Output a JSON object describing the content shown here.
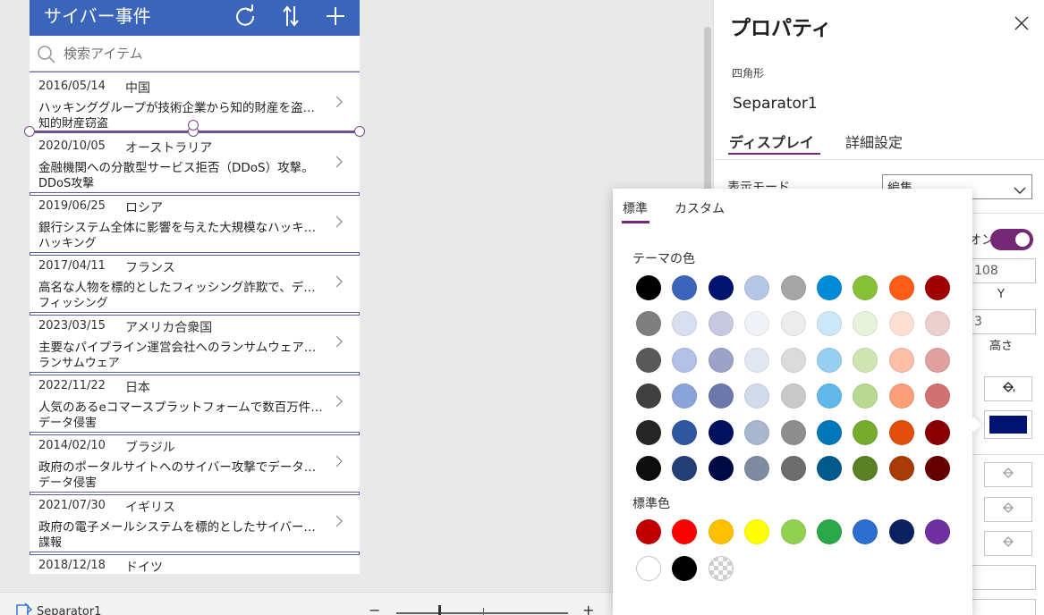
{
  "app": {
    "title": "サイバー事件",
    "search_placeholder": "検索アイテム",
    "rows": [
      {
        "date": "2016/05/14",
        "country": "中国",
        "desc": "ハッキンググループが技術企業から知的財産を盗…",
        "category": "知的財産窃盗"
      },
      {
        "date": "2020/10/05",
        "country": "オーストラリア",
        "desc": "金融機関への分散型サービス拒否（DDoS）攻撃。",
        "category": "DDoS攻撃"
      },
      {
        "date": "2019/06/25",
        "country": "ロシア",
        "desc": "銀行システム全体に影響を与えた大規模なハッキ…",
        "category": "ハッキング"
      },
      {
        "date": "2017/04/11",
        "country": "フランス",
        "desc": "高名な人物を標的としたフィッシング詐欺で、デ…",
        "category": "フィッシング"
      },
      {
        "date": "2023/03/15",
        "country": "アメリカ合衆国",
        "desc": "主要なパイプライン運営会社へのランサムウェア…",
        "category": "ランサムウェア"
      },
      {
        "date": "2022/11/22",
        "country": "日本",
        "desc": "人気のあるeコマースプラットフォームで数百万件…",
        "category": "データ侵害"
      },
      {
        "date": "2014/02/10",
        "country": "ブラジル",
        "desc": "政府のポータルサイトへのサイバー攻撃でデータ…",
        "category": "データ侵害"
      },
      {
        "date": "2021/07/30",
        "country": "イギリス",
        "desc": "政府の電子メールシステムを標的としたサイバー…",
        "category": "諜報"
      },
      {
        "date": "2018/12/18",
        "country": "ドイツ",
        "desc": "",
        "category": ""
      }
    ]
  },
  "status_bar": {
    "selected_control": "Separator1",
    "zoom_minus": "−",
    "zoom_plus": "+"
  },
  "panel": {
    "title": "プロパティ",
    "control_type": "四角形",
    "control_name": "Separator1",
    "tab_display": "ディスプレイ",
    "tab_advanced": "詳細設定",
    "partial_label": "表示モード",
    "display_mode_value": "編集",
    "toggle_text": "オン",
    "field_y_value": "108",
    "caption_y": "Y",
    "field_height_value": "3",
    "caption_height": "高さ",
    "fill_color": "#001370"
  },
  "color_picker": {
    "tab_standard": "標準",
    "tab_custom": "カスタム",
    "theme_heading": "テーマの色",
    "standard_heading": "標準色",
    "theme_rows": [
      [
        "#000000",
        "#3a65ba",
        "#001370",
        "#b5c6e6",
        "#a5a5a5",
        "#0089d6",
        "#88c038",
        "#fd5c19",
        "#a10000"
      ],
      [
        "#7f7f7f",
        "#d8dff1",
        "#c6c9df",
        "#f0f3f8",
        "#ececec",
        "#cbe7f8",
        "#e7f2da",
        "#fde0d4",
        "#ecd0d0"
      ],
      [
        "#595959",
        "#b2c1e5",
        "#9ba2c8",
        "#e2e8f2",
        "#dbdbdb",
        "#96cff0",
        "#cfe5b4",
        "#fcbfa5",
        "#e0a0a0"
      ],
      [
        "#404040",
        "#8aa3d9",
        "#6c77ab",
        "#d2dbeb",
        "#c9c9c9",
        "#62b7e9",
        "#b7d991",
        "#fb9f78",
        "#d17171"
      ],
      [
        "#262626",
        "#2f56a0",
        "#00115f",
        "#a8b6cf",
        "#8e8e8e",
        "#0077b8",
        "#78ac2f",
        "#e24e0c",
        "#8a0000"
      ],
      [
        "#0d0d0d",
        "#243f75",
        "#000b45",
        "#7f8ba0",
        "#6d6d6d",
        "#005a8c",
        "#5a8123",
        "#a93b09",
        "#660000"
      ]
    ],
    "standard_colors": [
      "#c00000",
      "#ff0000",
      "#ffc000",
      "#ffff00",
      "#92d050",
      "#2aa84a",
      "#2a6fcf",
      "#0c2162",
      "#7030a0",
      "#ffffff",
      "#000000",
      "transparent"
    ]
  }
}
